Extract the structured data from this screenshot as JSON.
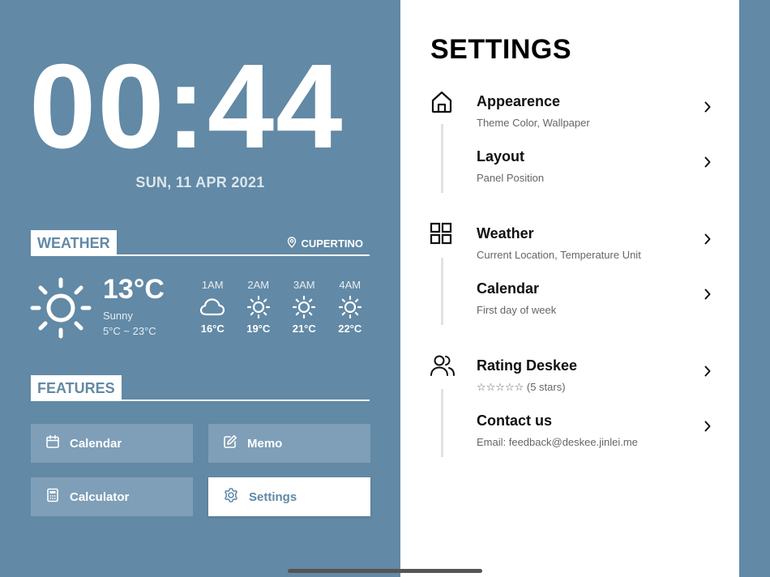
{
  "clock": {
    "time": "00:44",
    "date": "SUN, 11 APR 2021"
  },
  "weather": {
    "header": "WEATHER",
    "location": "CUPERTINO",
    "current": {
      "temp": "13°C",
      "condition": "Sunny",
      "range": "5°C ~ 23°C",
      "icon": "sun-icon"
    },
    "hourly": [
      {
        "time": "1AM",
        "icon": "cloud-icon",
        "temp": "16°C"
      },
      {
        "time": "2AM",
        "icon": "sun-icon",
        "temp": "19°C"
      },
      {
        "time": "3AM",
        "icon": "sun-icon",
        "temp": "21°C"
      },
      {
        "time": "4AM",
        "icon": "sun-icon",
        "temp": "22°C"
      }
    ]
  },
  "features": {
    "header": "FEATURES",
    "buttons": [
      {
        "label": "Calendar",
        "icon": "calendar-icon"
      },
      {
        "label": "Memo",
        "icon": "edit-icon"
      },
      {
        "label": "Calculator",
        "icon": "calculator-icon"
      },
      {
        "label": "Settings",
        "icon": "gear-icon",
        "active": true
      }
    ]
  },
  "settings": {
    "title": "SETTINGS",
    "items": [
      {
        "title": "Appearence",
        "subtitle": "Theme Color, Wallpaper"
      },
      {
        "title": "Layout",
        "subtitle": "Panel Position"
      },
      {
        "title": "Weather",
        "subtitle": "Current Location, Temperature Unit"
      },
      {
        "title": "Calendar",
        "subtitle": "First day of week"
      },
      {
        "title": "Rating Deskee",
        "subtitle": "☆☆☆☆☆ (5 stars)"
      },
      {
        "title": "Contact us",
        "subtitle": "Email: feedback@deskee.jinlei.me"
      }
    ],
    "group_icons": [
      "home-icon",
      "grid-icon",
      "users-icon"
    ]
  },
  "colors": {
    "accent": "#6289a5",
    "button": "#7e9fb7",
    "panel": "#ffffff"
  }
}
